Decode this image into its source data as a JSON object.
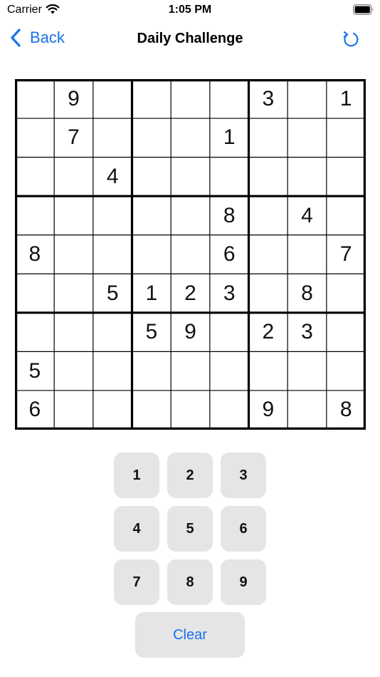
{
  "status_bar": {
    "carrier": "Carrier",
    "time": "1:05 PM"
  },
  "nav": {
    "back_label": "Back",
    "title": "Daily Challenge"
  },
  "colors": {
    "accent": "#1a73e8",
    "key_background": "#e5e5e7"
  },
  "grid": [
    [
      "",
      "9",
      "",
      "",
      "",
      "",
      "3",
      "",
      "1"
    ],
    [
      "",
      "7",
      "",
      "",
      "",
      "1",
      "",
      "",
      ""
    ],
    [
      "",
      "",
      "4",
      "",
      "",
      "",
      "",
      "",
      ""
    ],
    [
      "",
      "",
      "",
      "",
      "",
      "8",
      "",
      "4",
      ""
    ],
    [
      "8",
      "",
      "",
      "",
      "",
      "6",
      "",
      "",
      "7"
    ],
    [
      "",
      "",
      "5",
      "1",
      "2",
      "3",
      "",
      "8",
      ""
    ],
    [
      "",
      "",
      "",
      "5",
      "9",
      "",
      "2",
      "3",
      ""
    ],
    [
      "5",
      "",
      "",
      "",
      "",
      "",
      "",
      "",
      ""
    ],
    [
      "6",
      "",
      "",
      "",
      "",
      "",
      "9",
      "",
      "8"
    ]
  ],
  "keypad": {
    "keys": [
      "1",
      "2",
      "3",
      "4",
      "5",
      "6",
      "7",
      "8",
      "9"
    ],
    "clear_label": "Clear"
  }
}
